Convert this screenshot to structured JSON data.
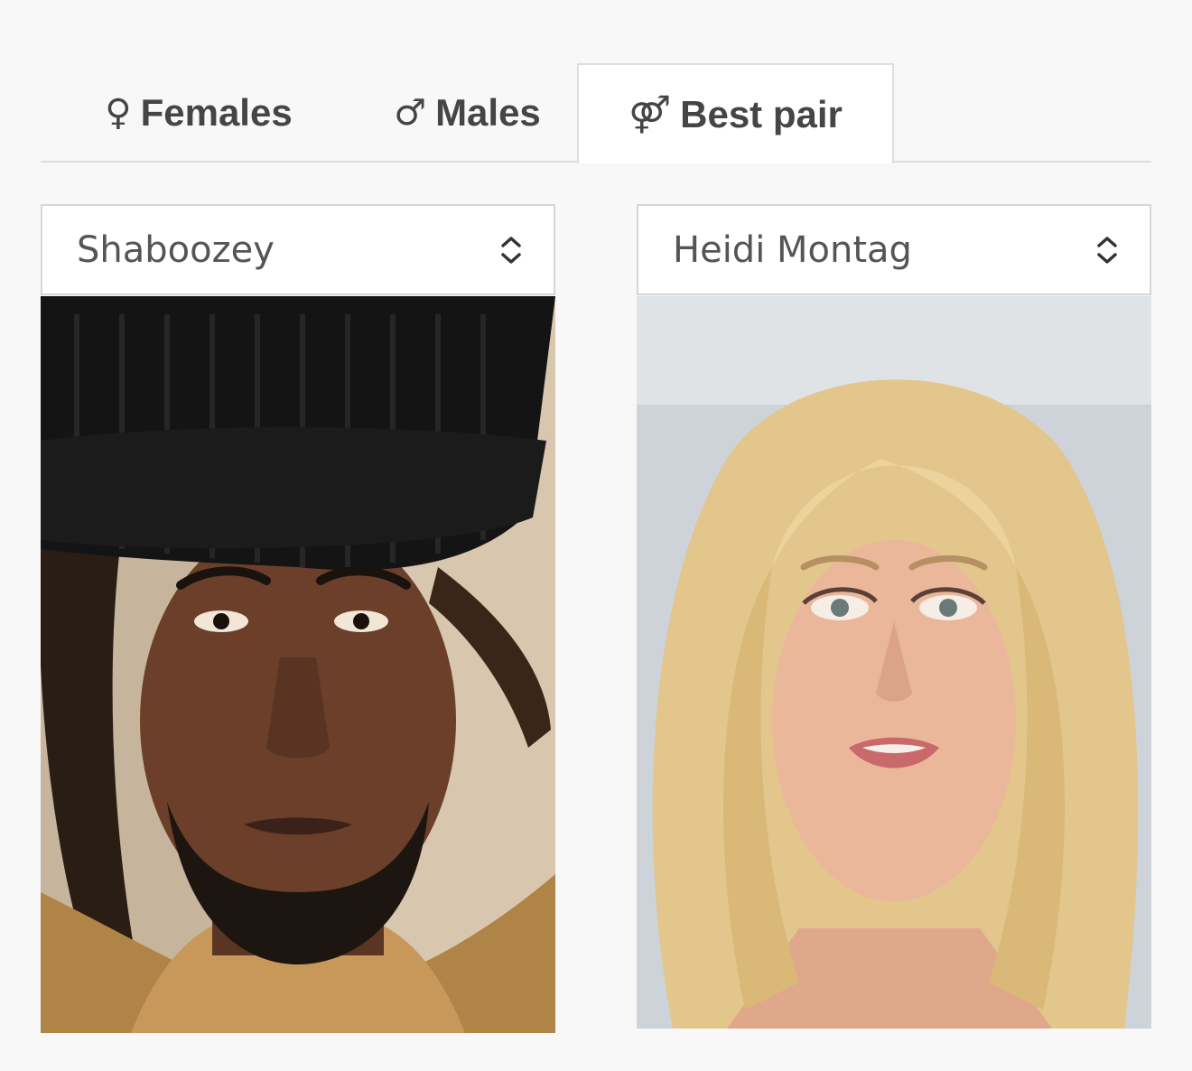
{
  "tabs": [
    {
      "symbol": "♀",
      "label": "Females",
      "active": false
    },
    {
      "symbol": "♂",
      "label": "Males",
      "active": false
    },
    {
      "symbol": "⚤",
      "label": "Best pair",
      "active": true
    }
  ],
  "pair": {
    "left": {
      "selected": "Shaboozey",
      "photo_alt": "Shaboozey"
    },
    "right": {
      "selected": "Heidi Montag",
      "photo_alt": "Heidi Montag"
    }
  },
  "icons": {
    "female": "female-symbol-icon",
    "male": "male-symbol-icon",
    "pair": "pair-symbol-icon",
    "select": "chevron-up-down-icon"
  },
  "colors": {
    "background": "#f8f8f8",
    "tab_text": "#454545",
    "border": "#dddddd",
    "select_text": "#555555"
  }
}
